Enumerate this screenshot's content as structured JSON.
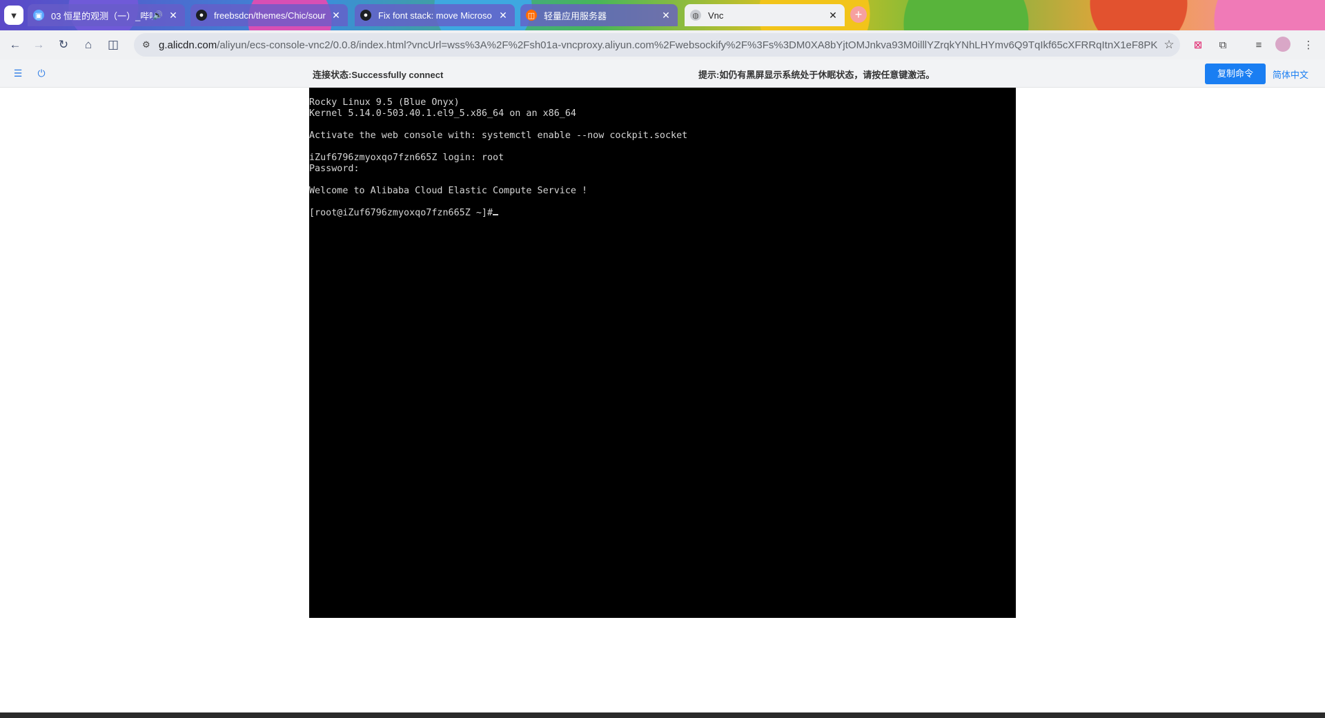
{
  "browser": {
    "tabs": [
      {
        "title": "03 恒星的观测（一）_哔哩",
        "favicon": "bilibili-icon",
        "audio": true,
        "active": false
      },
      {
        "title": "freebsdcn/themes/Chic/sour",
        "favicon": "github-icon",
        "active": false
      },
      {
        "title": "Fix font stack: move Microso",
        "favicon": "github-icon",
        "active": false
      },
      {
        "title": "轻量应用服务器",
        "favicon": "aliyun-icon",
        "active": false
      },
      {
        "title": "Vnc",
        "favicon": "globe-icon",
        "active": true
      }
    ],
    "close_glyph": "✕",
    "address": {
      "domain": "g.alicdn.com",
      "path": "/aliyun/ecs-console-vnc2/0.0.8/index.html?vncUrl=wss%3A%2F%2Fsh01a-vncproxy.aliyun.com%2Fwebsockify%2F%3Fs%3DM0XA8bYjtOMJnkva93M0illlYZrqkYNhLHYmv6Q9TqIkf65cXFRRqItnX1eF8PK..."
    }
  },
  "vnc": {
    "status": "连接状态:Successfully connect",
    "hint": "提示:如仍有黑屏显示系统处于休眠状态，请按任意键激活。",
    "copy_button": "复制命令",
    "language": "简体中文"
  },
  "terminal": {
    "lines": [
      "Rocky Linux 9.5 (Blue Onyx)",
      "Kernel 5.14.0-503.40.1.el9_5.x86_64 on an x86_64",
      "",
      "Activate the web console with: systemctl enable --now cockpit.socket",
      "",
      "iZuf6796zmyoxqo7fzn665Z login: root",
      "Password:",
      "",
      "Welcome to Alibaba Cloud Elastic Compute Service !",
      "",
      "[root@iZuf6796zmyoxqo7fzn665Z ~]#"
    ]
  }
}
